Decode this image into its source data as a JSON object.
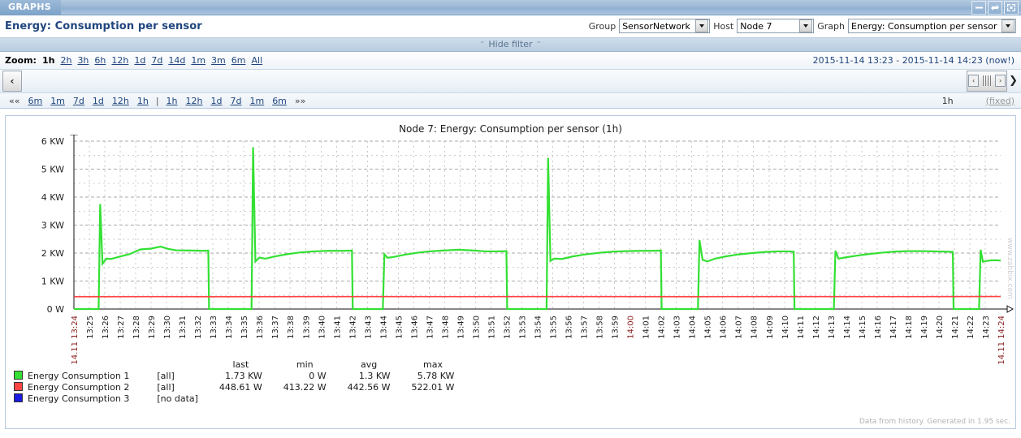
{
  "window": {
    "tab_label": "GRAPHS",
    "controls": [
      {
        "name": "minimize-button",
        "label": "Minimize"
      },
      {
        "name": "refresh-button",
        "label": "Refresh"
      },
      {
        "name": "fullscreen-button",
        "label": "Fullscreen"
      }
    ]
  },
  "page": {
    "title": "Energy: Consumption per sensor",
    "hide_filter_label": "Hide filter",
    "chevron": "⌃"
  },
  "filter": {
    "group_label": "Group",
    "group_value": "SensorNetwork",
    "host_label": "Host",
    "host_value": "Node 7",
    "graph_label": "Graph",
    "graph_value": "Energy: Consumption per sensor"
  },
  "zoom": {
    "label": "Zoom:",
    "links": [
      "1h",
      "2h",
      "3h",
      "6h",
      "12h",
      "1d",
      "7d",
      "14d",
      "1m",
      "3m",
      "6m",
      "All"
    ],
    "active": "1h"
  },
  "timenav": {
    "from": "2015-11-14 13:23",
    "dash": "-",
    "to": "2015-11-14 14:23 (now!)",
    "prev_button": "‹",
    "next_button": "❯",
    "grip_left": "‹",
    "grip_right": "›",
    "back_links": [
      "6m",
      "1m",
      "7d",
      "1d",
      "12h",
      "1h"
    ],
    "forward_links": [
      "1h",
      "12h",
      "1d",
      "7d",
      "1m",
      "6m"
    ],
    "first_label": "««",
    "last_label": "»»",
    "separator": "|",
    "period_value": "1h",
    "fixed_label": "(fixed)"
  },
  "graph": {
    "title": "Node 7: Energy: Consumption per sensor (1h)",
    "watermark": "www.zabbix.com",
    "footnote": "Data from history. Generated in 1.95 sec.",
    "legend_headers": [
      "last",
      "min",
      "avg",
      "max"
    ],
    "legend_rows": [
      {
        "color": "#33e033",
        "name": "Energy Consumption 1",
        "scope": "[all]",
        "last": "1.73 KW",
        "min": "0 W",
        "avg": "1.3 KW",
        "max": "5.78 KW"
      },
      {
        "color": "#ff4444",
        "name": "Energy Consumption 2",
        "scope": "[all]",
        "last": "448.61 W",
        "min": "413.22 W",
        "avg": "442.56 W",
        "max": "522.01 W"
      },
      {
        "color": "#1b1be0",
        "name": "Energy Consumption 3",
        "scope": "[no data]",
        "last": "",
        "min": "",
        "avg": "",
        "max": ""
      }
    ]
  },
  "chart_data": {
    "type": "line",
    "title": "Node 7: Energy: Consumption per sensor (1h)",
    "xlabel": "",
    "ylabel": "",
    "ylim": [
      0,
      6000
    ],
    "yunit": "W",
    "ytick_labels": [
      "0 W",
      "1 KW",
      "2 KW",
      "3 KW",
      "4 KW",
      "5 KW",
      "6 KW"
    ],
    "ytick_values": [
      0,
      1000,
      2000,
      3000,
      4000,
      5000,
      6000
    ],
    "grid": true,
    "legend_position": "below",
    "x_start_label": "14.11 13:24",
    "x_end_label": "14.11 14:24",
    "x_highlight_label": "14:00",
    "xtick_labels": [
      "13:25",
      "13:26",
      "13:27",
      "13:28",
      "13:29",
      "13:30",
      "13:31",
      "13:32",
      "13:33",
      "13:34",
      "13:35",
      "13:36",
      "13:37",
      "13:38",
      "13:39",
      "13:40",
      "13:41",
      "13:42",
      "13:43",
      "13:44",
      "13:45",
      "13:46",
      "13:47",
      "13:48",
      "13:49",
      "13:50",
      "13:51",
      "13:52",
      "13:53",
      "13:54",
      "13:55",
      "13:56",
      "13:57",
      "13:58",
      "13:59",
      "14:00",
      "14:01",
      "14:02",
      "14:03",
      "14:04",
      "14:05",
      "14:06",
      "14:07",
      "14:08",
      "14:09",
      "14:10",
      "14:11",
      "14:12",
      "14:13",
      "14:14",
      "14:15",
      "14:16",
      "14:17",
      "14:18",
      "14:19",
      "14:20",
      "14:21",
      "14:22",
      "14:23"
    ],
    "series": [
      {
        "name": "Energy Consumption 1",
        "color": "#33e033",
        "unit": "W",
        "points": [
          [
            0,
            0
          ],
          [
            1.6,
            0
          ],
          [
            1.7,
            3750
          ],
          [
            1.85,
            1620
          ],
          [
            2.1,
            1800
          ],
          [
            2.4,
            1790
          ],
          [
            3.0,
            1880
          ],
          [
            3.6,
            1960
          ],
          [
            4.3,
            2130
          ],
          [
            5.0,
            2160
          ],
          [
            5.6,
            2230
          ],
          [
            6.1,
            2150
          ],
          [
            6.6,
            2100
          ],
          [
            7.6,
            2090
          ],
          [
            8.4,
            2080
          ],
          [
            8.7,
            2090
          ],
          [
            8.75,
            0
          ],
          [
            9.0,
            0
          ],
          [
            11.5,
            0
          ],
          [
            11.6,
            5780
          ],
          [
            11.75,
            1700
          ],
          [
            12.0,
            1840
          ],
          [
            12.4,
            1800
          ],
          [
            13.0,
            1880
          ],
          [
            13.8,
            1960
          ],
          [
            14.6,
            2020
          ],
          [
            15.5,
            2060
          ],
          [
            16.4,
            2080
          ],
          [
            17.4,
            2080
          ],
          [
            18.0,
            2090
          ],
          [
            18.05,
            0
          ],
          [
            18.4,
            0
          ],
          [
            20.0,
            0
          ],
          [
            20.1,
            1960
          ],
          [
            20.3,
            1830
          ],
          [
            20.7,
            1860
          ],
          [
            21.4,
            1940
          ],
          [
            22.2,
            2010
          ],
          [
            23.0,
            2060
          ],
          [
            23.9,
            2090
          ],
          [
            24.9,
            2120
          ],
          [
            25.9,
            2090
          ],
          [
            26.7,
            2060
          ],
          [
            27.4,
            2060
          ],
          [
            28.0,
            2070
          ],
          [
            28.05,
            0
          ],
          [
            28.4,
            0
          ],
          [
            30.6,
            0
          ],
          [
            30.7,
            5400
          ],
          [
            30.85,
            1720
          ],
          [
            31.1,
            1800
          ],
          [
            31.6,
            1790
          ],
          [
            32.3,
            1880
          ],
          [
            33.1,
            1950
          ],
          [
            34.0,
            2010
          ],
          [
            34.9,
            2050
          ],
          [
            35.8,
            2070
          ],
          [
            36.6,
            2080
          ],
          [
            37.4,
            2080
          ],
          [
            38.0,
            2090
          ],
          [
            38.05,
            0
          ],
          [
            38.4,
            0
          ],
          [
            40.4,
            0
          ],
          [
            40.5,
            2460
          ],
          [
            40.7,
            1760
          ],
          [
            41.0,
            1700
          ],
          [
            41.5,
            1800
          ],
          [
            42.2,
            1880
          ],
          [
            43.0,
            1950
          ],
          [
            43.9,
            2000
          ],
          [
            44.8,
            2040
          ],
          [
            45.6,
            2060
          ],
          [
            46.2,
            2060
          ],
          [
            46.6,
            2050
          ],
          [
            46.65,
            0
          ],
          [
            47.0,
            0
          ],
          [
            49.2,
            0
          ],
          [
            49.3,
            2080
          ],
          [
            49.5,
            1800
          ],
          [
            49.9,
            1840
          ],
          [
            50.6,
            1900
          ],
          [
            51.4,
            1960
          ],
          [
            52.2,
            2010
          ],
          [
            53.1,
            2050
          ],
          [
            54.0,
            2070
          ],
          [
            54.9,
            2070
          ],
          [
            55.7,
            2060
          ],
          [
            56.4,
            2050
          ],
          [
            56.9,
            2040
          ],
          [
            56.95,
            0
          ],
          [
            57.3,
            0
          ],
          [
            58.6,
            0
          ],
          [
            58.7,
            2120
          ],
          [
            58.85,
            1690
          ],
          [
            59.1,
            1720
          ],
          [
            59.4,
            1740
          ],
          [
            59.7,
            1745
          ],
          [
            60,
            1730
          ]
        ]
      },
      {
        "name": "Energy Consumption 2",
        "color": "#ff4444",
        "unit": "W",
        "constant_approx": 443,
        "points": [
          [
            0,
            440
          ],
          [
            5,
            442
          ],
          [
            10,
            441
          ],
          [
            15,
            444
          ],
          [
            20,
            443
          ],
          [
            25,
            442
          ],
          [
            30,
            445
          ],
          [
            35,
            443
          ],
          [
            40,
            441
          ],
          [
            45,
            444
          ],
          [
            50,
            443
          ],
          [
            55,
            442
          ],
          [
            60,
            448
          ]
        ]
      },
      {
        "name": "Energy Consumption 3",
        "color": "#1b1be0",
        "unit": "W",
        "points": []
      }
    ]
  }
}
